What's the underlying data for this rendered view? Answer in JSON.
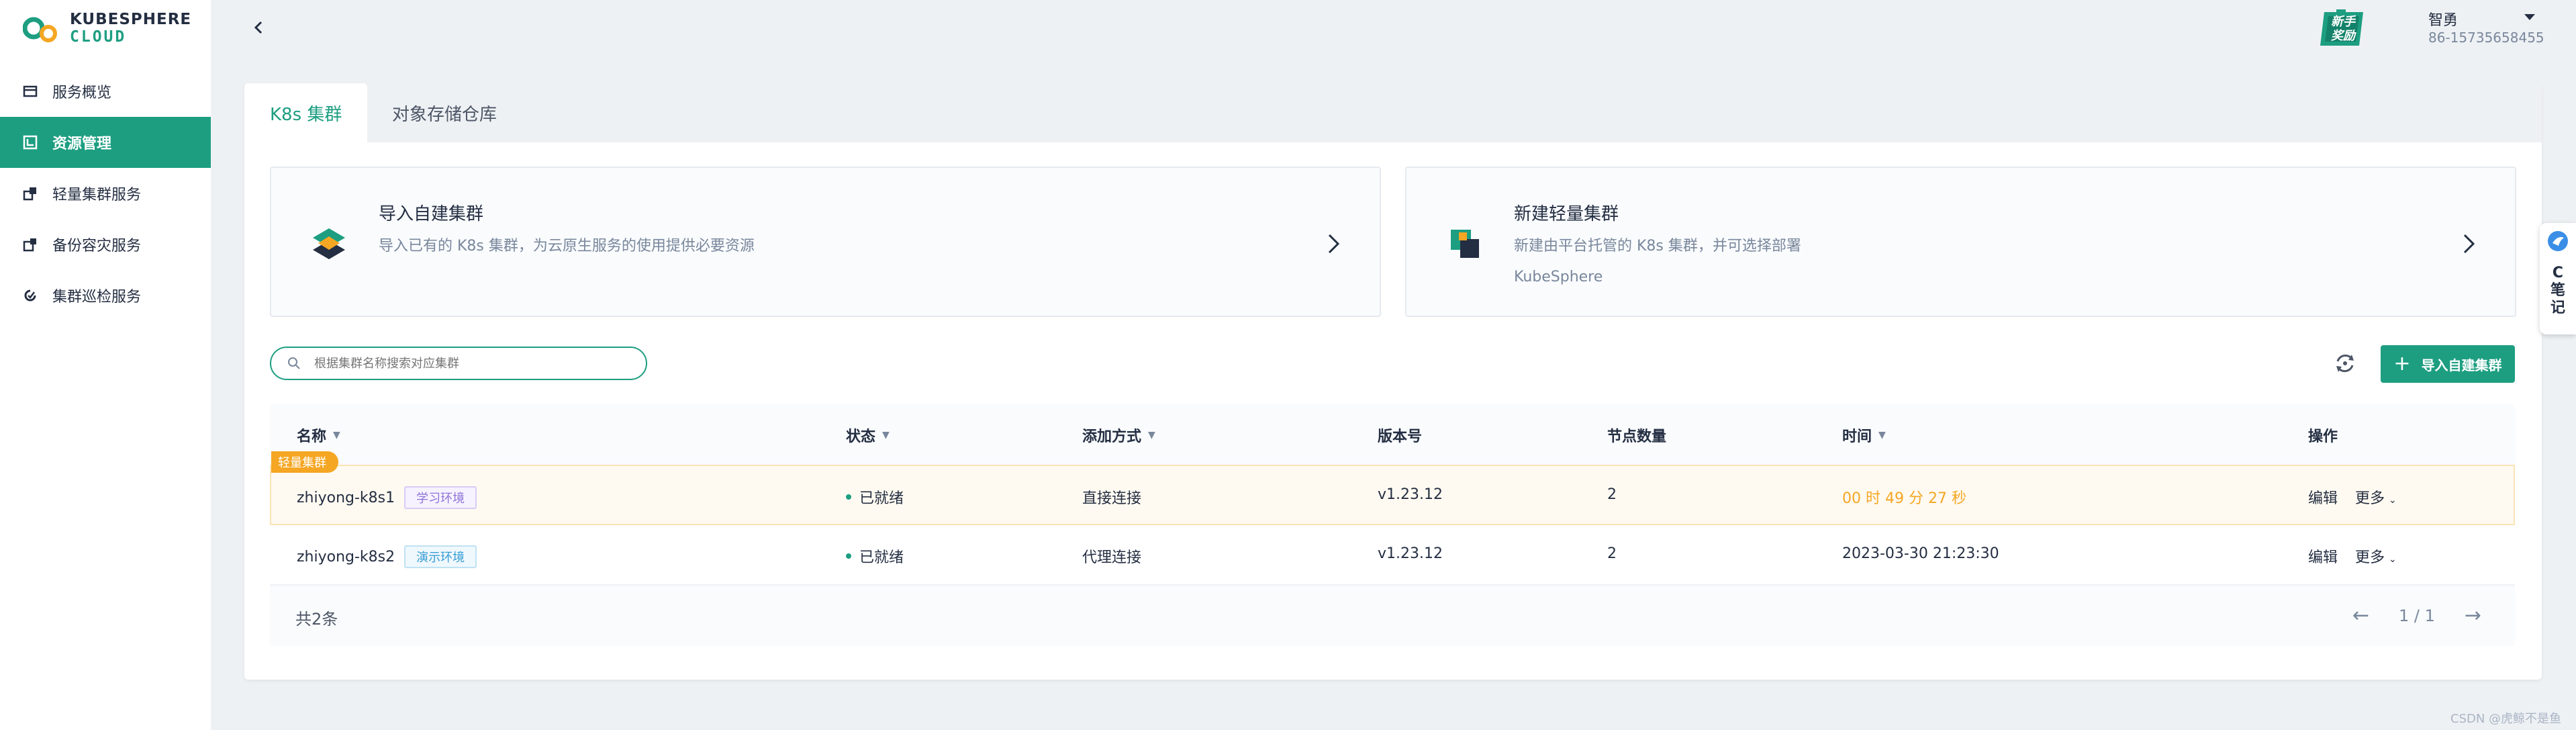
{
  "brand": {
    "line1": "KUBESPHERE",
    "line2": "CLOUD",
    "accent": "#1d9e81"
  },
  "sidebar": {
    "items": [
      {
        "label": "服务概览",
        "icon": "card-icon"
      },
      {
        "label": "资源管理",
        "icon": "resource-icon",
        "active": true
      },
      {
        "label": "轻量集群服务",
        "icon": "cluster-icon"
      },
      {
        "label": "备份容灾服务",
        "icon": "backup-icon"
      },
      {
        "label": "集群巡检服务",
        "icon": "inspect-icon"
      }
    ]
  },
  "header": {
    "newbie_badge": "新手奖励",
    "user_name": "智勇",
    "user_phone": "86-15735658455"
  },
  "tabs": [
    "K8s 集群",
    "对象存储仓库"
  ],
  "options": [
    {
      "title": "导入自建集群",
      "desc": "导入已有的 K8s 集群，为云原生服务的使用提供必要资源"
    },
    {
      "title": "新建轻量集群",
      "desc": "新建由平台托管的 K8s 集群，并可选择部署 KubeSphere"
    }
  ],
  "search": {
    "placeholder": "根据集群名称搜索对应集群"
  },
  "actions": {
    "import_label": "导入自建集群"
  },
  "table": {
    "columns": [
      "名称",
      "状态",
      "添加方式",
      "版本号",
      "节点数量",
      "时间",
      "操作"
    ],
    "rows": [
      {
        "badge": "轻量集群",
        "name": "zhiyong-k8s1",
        "tag": "学习环境",
        "status": "已就绪",
        "method": "直接连接",
        "version": "v1.23.12",
        "nodes": "2",
        "time": "00 时 49 分 27 秒",
        "edit": "编辑",
        "more": "更多"
      },
      {
        "name": "zhiyong-k8s2",
        "tag": "演示环境",
        "status": "已就绪",
        "method": "代理连接",
        "version": "v1.23.12",
        "nodes": "2",
        "time": "2023-03-30 21:23:30",
        "edit": "编辑",
        "more": "更多"
      }
    ],
    "total": "共2条",
    "page": "1 / 1"
  },
  "side_widget": {
    "label": "C\n笔\n记"
  },
  "watermark": "CSDN @虎鲸不是鱼"
}
